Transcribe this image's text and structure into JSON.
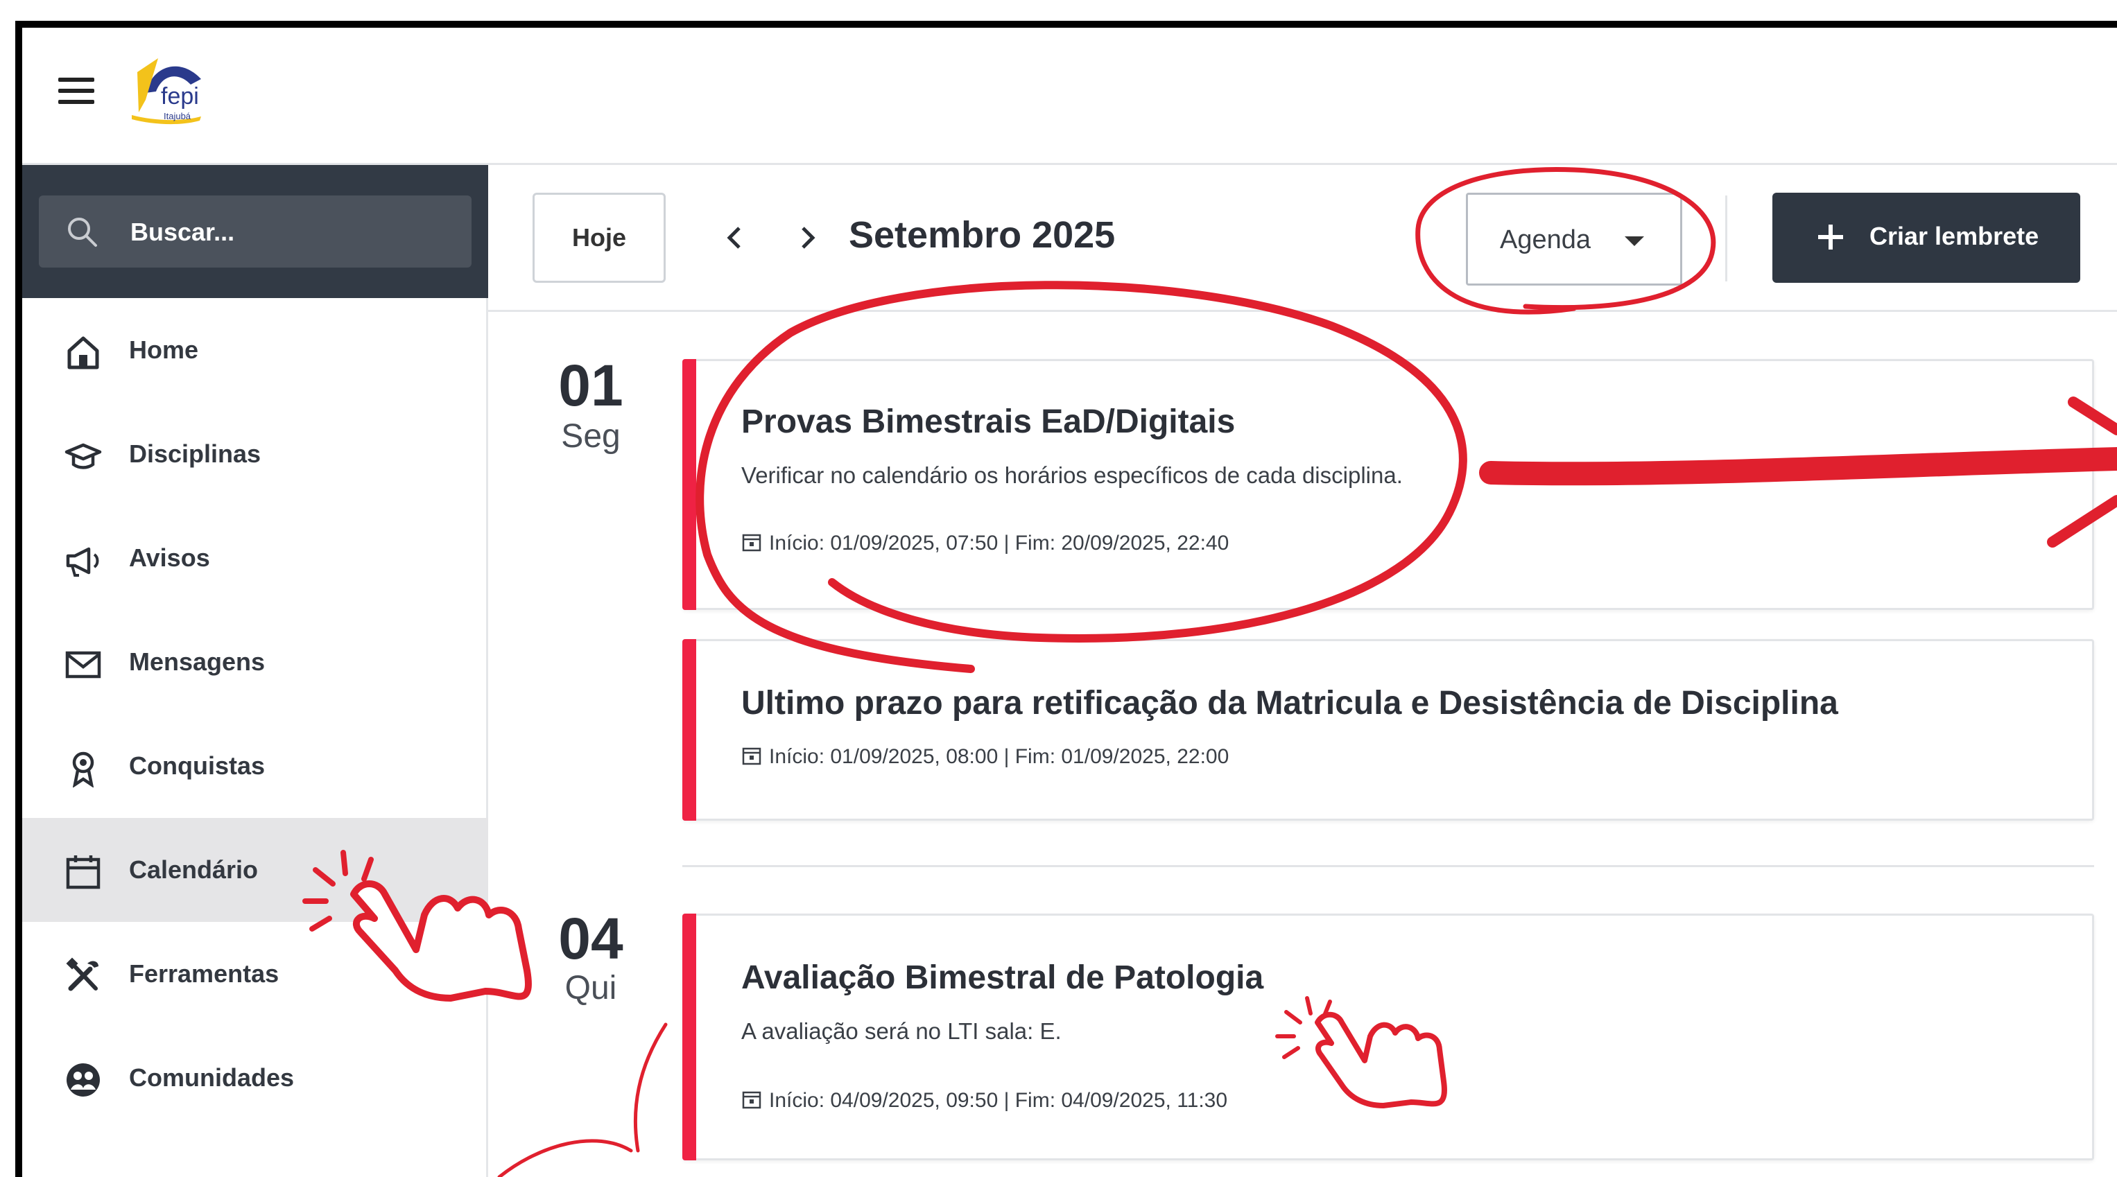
{
  "header": {
    "menu_icon": "hamburger-icon",
    "logo_text": "fepi",
    "logo_subtext": "Itajubá"
  },
  "sidebar": {
    "search_placeholder": "Buscar...",
    "items": [
      {
        "label": "Home",
        "icon": "home-icon"
      },
      {
        "label": "Disciplinas",
        "icon": "graduation-cap-icon"
      },
      {
        "label": "Avisos",
        "icon": "megaphone-icon"
      },
      {
        "label": "Mensagens",
        "icon": "envelope-icon"
      },
      {
        "label": "Conquistas",
        "icon": "award-icon"
      },
      {
        "label": "Calendário",
        "icon": "calendar-icon",
        "active": true
      },
      {
        "label": "Ferramentas",
        "icon": "tools-icon"
      },
      {
        "label": "Comunidades",
        "icon": "community-icon"
      }
    ]
  },
  "toolbar": {
    "today_label": "Hoje",
    "month_title": "Setembro 2025",
    "view_value": "Agenda",
    "create_label": "Criar lembrete"
  },
  "days": [
    {
      "num": "01",
      "name": "Seg",
      "events": [
        {
          "title": "Provas Bimestrais EaD/Digitais",
          "desc": "Verificar no calendário os horários específicos de cada disciplina.",
          "date": "Início: 01/09/2025, 07:50 | Fim: 20/09/2025, 22:40"
        },
        {
          "title": "Ultimo prazo para retificação da Matricula e Desistência de Disciplina",
          "date": "Início: 01/09/2025, 08:00 | Fim: 01/09/2025, 22:00"
        }
      ]
    },
    {
      "num": "04",
      "name": "Qui",
      "events": [
        {
          "title": "Avaliação Bimestral de Patologia",
          "desc": "A avaliação será no LTI sala: E.",
          "date": "Início: 04/09/2025, 09:50 | Fim: 04/09/2025, 11:30"
        }
      ]
    }
  ],
  "colors": {
    "accent": "#ef2244",
    "sidebar_dark": "#323a45",
    "annotation_red": "#e0202e"
  }
}
